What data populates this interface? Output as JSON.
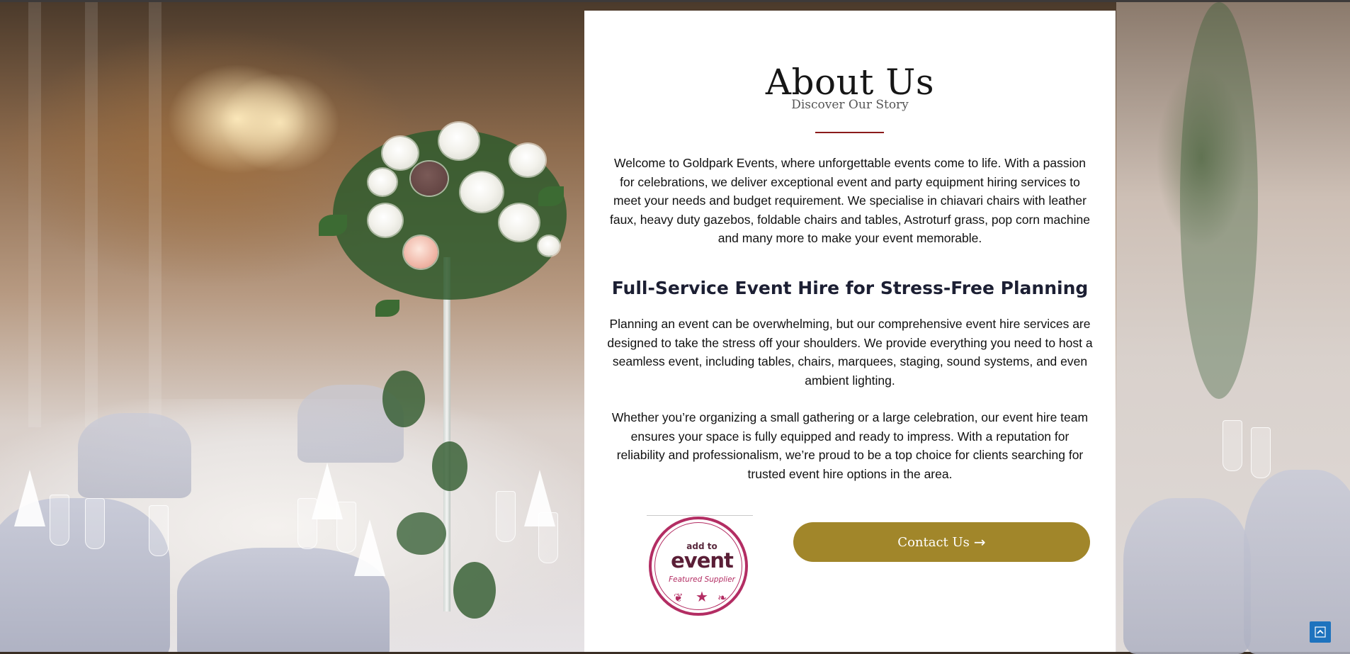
{
  "about": {
    "title": "About Us",
    "subtitle": "Discover Our Story",
    "intro": "Welcome to Goldpark Events, where unforgettable events come to life. With a passion for celebrations, we deliver exceptional event and party equipment hiring services to meet your needs and budget requirement. We specialise in chiavari chairs with leather faux, heavy duty gazebos, foldable chairs and tables, Astroturf grass, pop corn machine and many more to make your event memorable.",
    "heading": "Full-Service Event Hire for Stress-Free Planning",
    "para2": "Planning an event can be overwhelming, but our comprehensive event hire services are designed to take the stress off your shoulders. We provide everything you need to host a seamless event, including tables, chairs, marquees, staging, sound systems, and even ambient lighting.",
    "para3": "Whether you’re organizing a small gathering or a large celebration, our event hire team ensures your space is fully equipped and ready to impress. With a reputation for reliability and professionalism, we’re proud to be a top choice for clients searching for trusted event hire options in the area."
  },
  "badge": {
    "line1": "add to",
    "line2": "event",
    "line3": "Featured Supplier"
  },
  "contact_button": {
    "label": "Contact Us",
    "icon": "arrow-right-icon"
  },
  "scroll_top": {
    "icon": "chevron-up-icon"
  },
  "colors": {
    "accent_gold": "#a1862a",
    "divider_red": "#8b1a1a",
    "badge_magenta": "#b32d63",
    "scroll_blue": "#1e73be",
    "heading_navy": "#1c1f33"
  }
}
